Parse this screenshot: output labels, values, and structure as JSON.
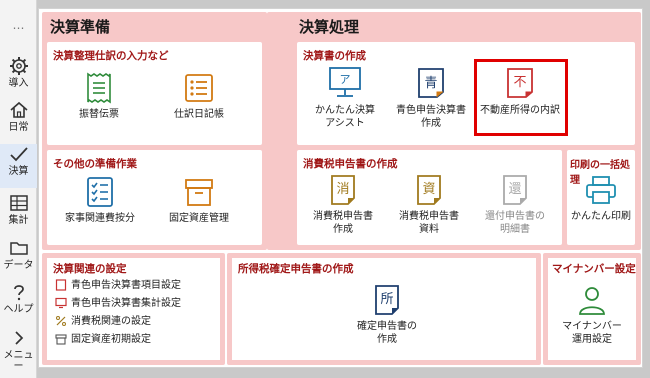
{
  "sidebar": {
    "more": "…",
    "items": [
      {
        "label": "導入"
      },
      {
        "label": "日常"
      },
      {
        "label": "決算"
      },
      {
        "label": "集計"
      },
      {
        "label": "データ"
      },
      {
        "label": "ヘルプ"
      },
      {
        "label": "メニュー"
      }
    ]
  },
  "prep": {
    "title": "決算準備",
    "cards": [
      {
        "title": "決算整理仕訳の入力など",
        "tiles": [
          {
            "label": "振替伝票"
          },
          {
            "label": "仕訳日記帳"
          }
        ]
      },
      {
        "title": "その他の準備作業",
        "tiles": [
          {
            "label": "家事関連費按分"
          },
          {
            "label": "固定資産管理"
          }
        ]
      }
    ]
  },
  "proc": {
    "title": "決算処理",
    "statements": {
      "title": "決算書の作成",
      "tiles": [
        {
          "label_1": "かんたん決算",
          "label_2": "アシスト"
        },
        {
          "label_1": "青色申告決算書",
          "label_2": "作成"
        },
        {
          "label_1": "不動産所得の内訳",
          "label_2": ""
        }
      ]
    },
    "tax": {
      "title": "消費税申告書の作成",
      "tiles": [
        {
          "label_1": "消費税申告書",
          "label_2": "作成"
        },
        {
          "label_1": "消費税申告書",
          "label_2": "資料"
        },
        {
          "label_1": "還付申告書の",
          "label_2": "明細書"
        }
      ]
    },
    "print": {
      "title": "印刷の一括処理",
      "tiles": [
        {
          "label": "かんたん印刷"
        }
      ]
    }
  },
  "settings": {
    "title": "決算関連の設定",
    "items": [
      {
        "label": "青色申告決算書項目設定"
      },
      {
        "label": "青色申告決算書集計設定"
      },
      {
        "label": "消費税関連の設定"
      },
      {
        "label": "固定資産初期設定"
      }
    ]
  },
  "income": {
    "title": "所得税確定申告書の作成",
    "tile": {
      "label_1": "確定申告書の",
      "label_2": "作成"
    }
  },
  "mynumber": {
    "title": "マイナンバー設定",
    "tile": {
      "label_1": "マイナンバー",
      "label_2": "運用設定"
    }
  },
  "icon_glyphs": {
    "kantan": "ア",
    "blue": "青",
    "fudosan": "不",
    "shohi": "消",
    "shiryo": "資",
    "kanpu": "還",
    "kakutei": "所"
  },
  "colors": {
    "section_bg": "#f7c8c8",
    "card_title": "#a01818",
    "icon_green": "#2e8b3a",
    "icon_orange": "#d27a12",
    "icon_blue": "#1f6fa8",
    "selection": "#e00000"
  }
}
